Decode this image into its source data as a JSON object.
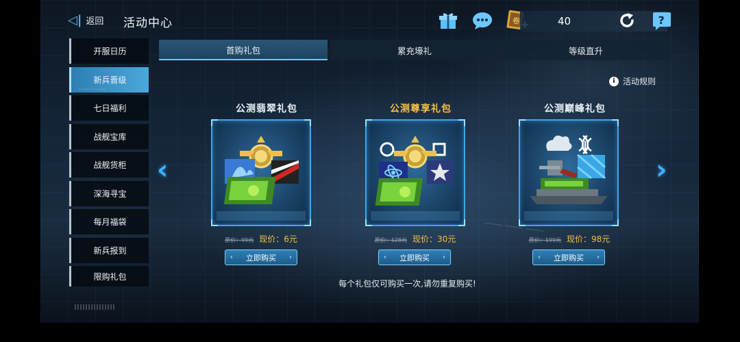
{
  "header": {
    "back_label": "返回",
    "title": "活动中心",
    "currency_value": "40",
    "icons": [
      "gift-icon",
      "chat-icon",
      "coupon-icon",
      "refresh-icon",
      "help-icon"
    ]
  },
  "sidebar": {
    "items": [
      {
        "label": "开服日历"
      },
      {
        "label": "新兵晋级"
      },
      {
        "label": "七日福利"
      },
      {
        "label": "战舰宝库"
      },
      {
        "label": "战舰货柜"
      },
      {
        "label": "深海寻宝"
      },
      {
        "label": "每月福袋"
      },
      {
        "label": "新兵报到"
      },
      {
        "label": "限购礼包"
      }
    ],
    "active_index": 1
  },
  "tabs": [
    {
      "label": "首购礼包"
    },
    {
      "label": "累充壕礼"
    },
    {
      "label": "等级直升"
    }
  ],
  "active_tab": 0,
  "rules_label": "活动规则",
  "packages": [
    {
      "title": "公测翡翠礼包",
      "original_price": "原价：99元",
      "now_label": "现价：",
      "now_price": "6元",
      "buy_label": "立即购买"
    },
    {
      "title": "公测尊享礼包",
      "original_price": "原价：128元",
      "now_label": "现价：",
      "now_price": "30元",
      "buy_label": "立即购买"
    },
    {
      "title": "公测巅峰礼包",
      "original_price": "原价：199元",
      "now_label": "现价：",
      "now_price": "98元",
      "buy_label": "立即购买"
    }
  ],
  "notice": "每个礼包仅可购买一次,请勿重复购买!",
  "colors": {
    "accent": "#3fa7e6",
    "gold": "#f2c04a",
    "active_menu": "#3a94c8"
  }
}
